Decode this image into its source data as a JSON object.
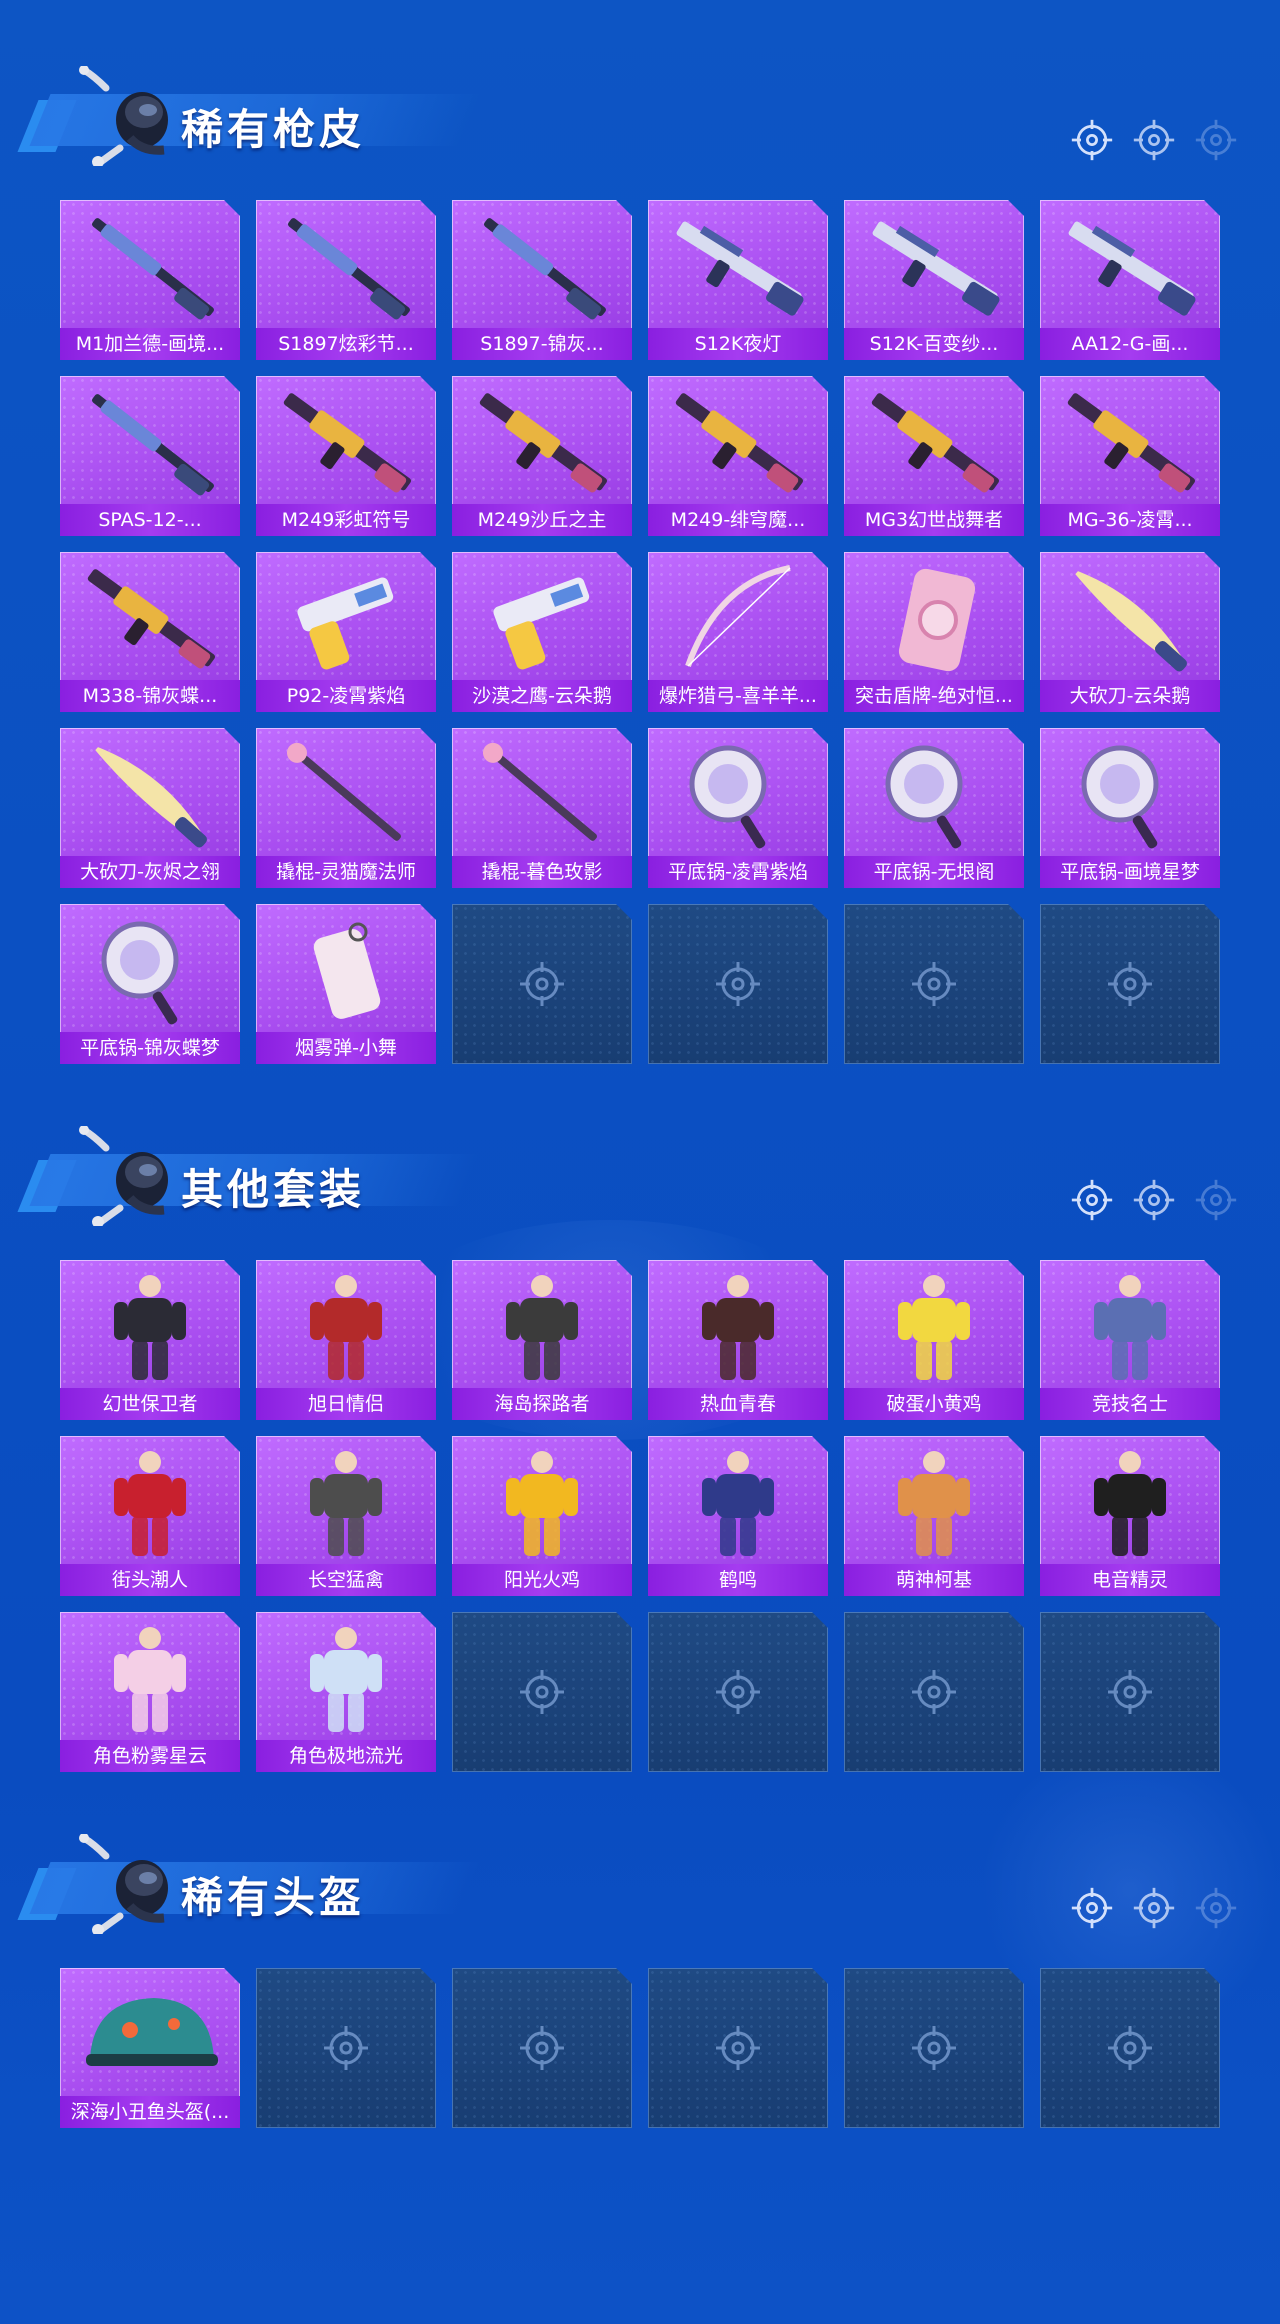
{
  "sections": [
    {
      "title": "稀有枪皮",
      "items": [
        {
          "label": "M1加兰德-画境...",
          "icon": "rifle-icon"
        },
        {
          "label": "S1897炫彩节...",
          "icon": "shotgun-icon"
        },
        {
          "label": "S1897-锦灰...",
          "icon": "shotgun-icon"
        },
        {
          "label": "S12K夜灯",
          "icon": "assault-rifle-icon"
        },
        {
          "label": "S12K-百变纱...",
          "icon": "assault-rifle-icon"
        },
        {
          "label": "AA12-G-画...",
          "icon": "assault-rifle-icon"
        },
        {
          "label": "SPAS-12-...",
          "icon": "shotgun-icon"
        },
        {
          "label": "M249彩虹符号",
          "icon": "machine-gun-icon"
        },
        {
          "label": "M249沙丘之主",
          "icon": "machine-gun-icon"
        },
        {
          "label": "M249-绯穹魔...",
          "icon": "machine-gun-icon"
        },
        {
          "label": "MG3幻世战舞者",
          "icon": "machine-gun-icon"
        },
        {
          "label": "MG-36-凌霄...",
          "icon": "machine-gun-icon"
        },
        {
          "label": "M338-锦灰蝶...",
          "icon": "machine-gun-icon"
        },
        {
          "label": "P92-凌霄紫焰",
          "icon": "pistol-icon"
        },
        {
          "label": "沙漠之鹰-云朵鹅",
          "icon": "pistol-icon"
        },
        {
          "label": "爆炸猎弓-喜羊羊...",
          "icon": "bow-icon"
        },
        {
          "label": "突击盾牌-绝对恒...",
          "icon": "shield-icon"
        },
        {
          "label": "大砍刀-云朵鹅",
          "icon": "machete-icon"
        },
        {
          "label": "大砍刀-灰烬之翎",
          "icon": "machete-icon"
        },
        {
          "label": "撬棍-灵猫魔法师",
          "icon": "crowbar-icon"
        },
        {
          "label": "撬棍-暮色玫影",
          "icon": "crowbar-icon"
        },
        {
          "label": "平底锅-凌霄紫焰",
          "icon": "pan-icon"
        },
        {
          "label": "平底锅-无垠阁",
          "icon": "pan-icon"
        },
        {
          "label": "平底锅-画境星梦",
          "icon": "pan-icon"
        },
        {
          "label": "平底锅-锦灰蝶梦",
          "icon": "pan-icon"
        },
        {
          "label": "烟雾弹-小舞",
          "icon": "smoke-grenade-icon"
        }
      ],
      "empty_slots": 4
    },
    {
      "title": "其他套装",
      "items": [
        {
          "label": "幻世保卫者",
          "icon": "outfit-icon",
          "color": "#2b2b35"
        },
        {
          "label": "旭日情侣",
          "icon": "outfit-icon",
          "color": "#b32a2a"
        },
        {
          "label": "海岛探路者",
          "icon": "outfit-icon",
          "color": "#3b3b3b"
        },
        {
          "label": "热血青春",
          "icon": "outfit-icon",
          "color": "#4a2a2a"
        },
        {
          "label": "破蛋小黄鸡",
          "icon": "outfit-icon",
          "color": "#f2d840"
        },
        {
          "label": "竞技名士",
          "icon": "outfit-icon",
          "color": "#5b6fb3"
        },
        {
          "label": "街头潮人",
          "icon": "outfit-icon",
          "color": "#c8202e"
        },
        {
          "label": "长空猛禽",
          "icon": "outfit-icon",
          "color": "#4d4d4d"
        },
        {
          "label": "阳光火鸡",
          "icon": "outfit-icon",
          "color": "#f2b820"
        },
        {
          "label": "鹤鸣",
          "icon": "outfit-icon",
          "color": "#2f3a8a"
        },
        {
          "label": "萌神柯基",
          "icon": "outfit-icon",
          "color": "#e0914a"
        },
        {
          "label": "电音精灵",
          "icon": "outfit-icon",
          "color": "#1f1f1f"
        },
        {
          "label": "角色粉雾星云",
          "icon": "outfit-icon",
          "color": "#f4cfe6"
        },
        {
          "label": "角色极地流光",
          "icon": "outfit-icon",
          "color": "#cfe0f6"
        }
      ],
      "empty_slots": 4
    },
    {
      "title": "稀有头盔",
      "items": [
        {
          "label": "深海小丑鱼头盔(...",
          "icon": "helmet-icon"
        }
      ],
      "empty_slots": 5
    }
  ],
  "colors": {
    "background": "#0b50c2",
    "card": "#a94ef0",
    "label_bar": "#8a1fe0",
    "empty_card": "#1f4a84"
  }
}
